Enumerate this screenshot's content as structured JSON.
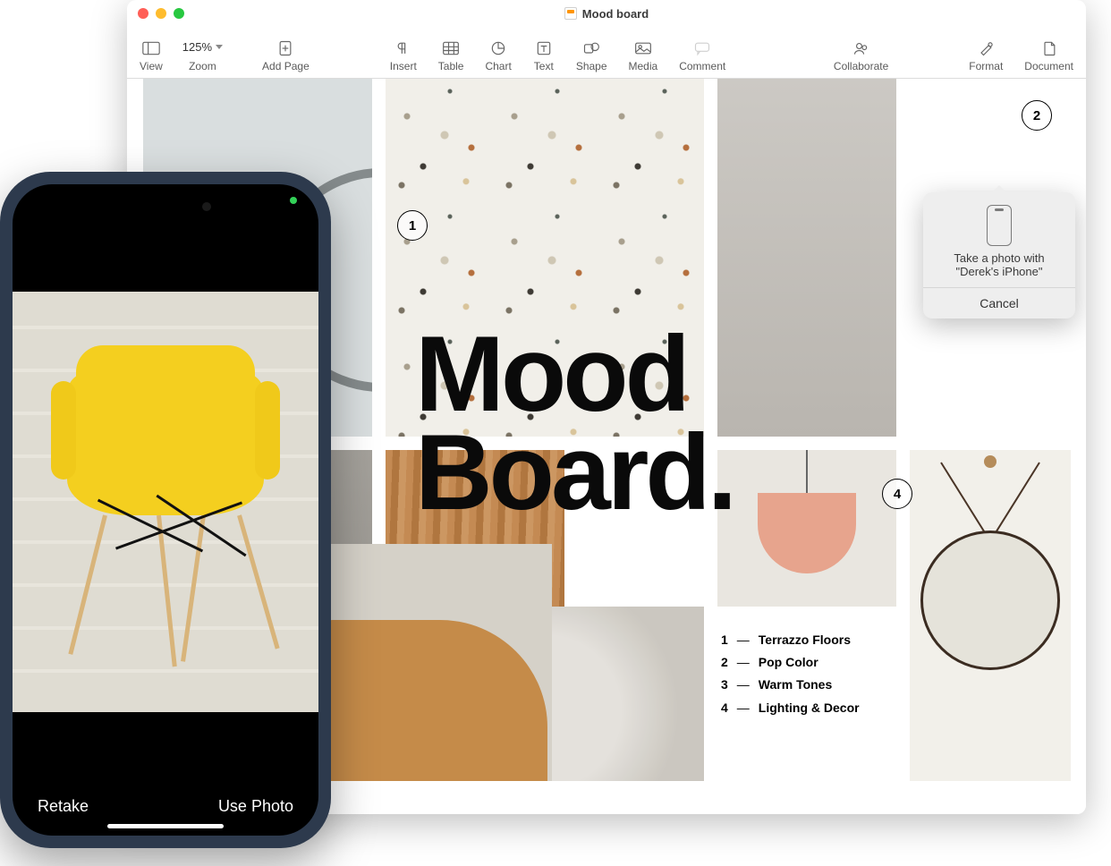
{
  "window": {
    "title": "Mood board"
  },
  "toolbar": {
    "view": "View",
    "zoom_value": "125%",
    "zoom": "Zoom",
    "add_page": "Add Page",
    "insert": "Insert",
    "table": "Table",
    "chart": "Chart",
    "text": "Text",
    "shape": "Shape",
    "media": "Media",
    "comment": "Comment",
    "collaborate": "Collaborate",
    "format": "Format",
    "document": "Document"
  },
  "document": {
    "headline_line1": "Mood",
    "headline_line2": "Board.",
    "callouts": {
      "c1": "1",
      "c2": "2",
      "c4": "4"
    },
    "legend": [
      {
        "n": "1",
        "label": "Terrazzo Floors"
      },
      {
        "n": "2",
        "label": "Pop Color"
      },
      {
        "n": "3",
        "label": "Warm Tones"
      },
      {
        "n": "4",
        "label": "Lighting & Decor"
      }
    ]
  },
  "popover": {
    "text_line1": "Take a photo with",
    "text_line2": "\"Derek's iPhone\"",
    "cancel": "Cancel"
  },
  "iphone": {
    "retake": "Retake",
    "use_photo": "Use Photo"
  }
}
